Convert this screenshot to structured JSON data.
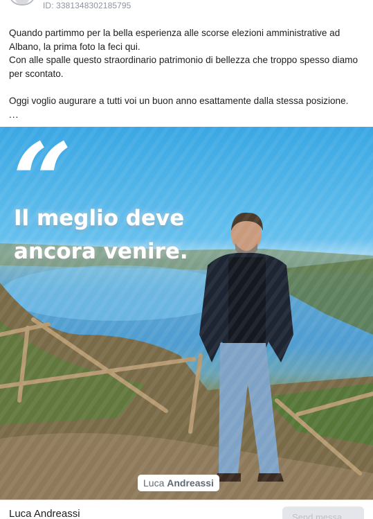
{
  "header": {
    "post_id": "ID: 3381348302185795"
  },
  "post": {
    "paragraphs": [
      "Quando partimmo per la bella esperienza alle scorse elezioni amministrative ad Albano, la prima foto la feci qui.",
      "Con alle spalle questo straordinario patrimonio di bellezza che troppo spesso diamo per scontato.",
      "Oggi voglio augurare a tutti voi un buon anno esattamente dalla stessa posizione."
    ],
    "see_more": "..."
  },
  "image": {
    "quote_mark": "“",
    "headline_line1": "Il meglio deve",
    "headline_line2": "ancora venire.",
    "signature_first": "Luca ",
    "signature_last": "Andreassi"
  },
  "footer": {
    "author_name": "Luca Andreassi",
    "send_button_label": "Send messa..."
  },
  "colors": {
    "sky": "#3aa7e3",
    "lake": "#4f9dd2",
    "text": "#1c1e21",
    "muted": "#8d949e"
  }
}
